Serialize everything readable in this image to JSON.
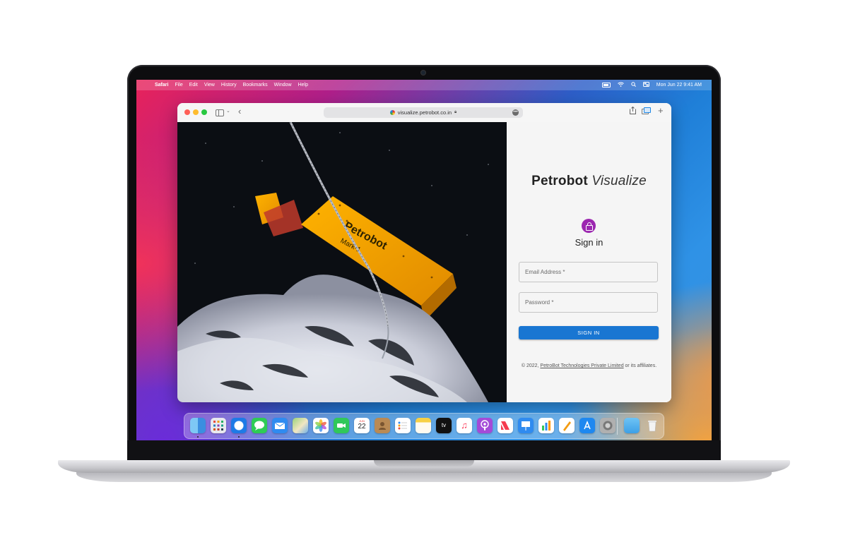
{
  "menubar": {
    "app": "Safari",
    "menus": [
      "File",
      "Edit",
      "View",
      "History",
      "Bookmarks",
      "Window",
      "Help"
    ],
    "clock": "Mon Jun 22  9:41 AM"
  },
  "browser": {
    "url": "visualize.petrobot.co.in"
  },
  "login": {
    "brand_strong": "Petrobot",
    "brand_light": "Visualize",
    "title": "Sign in",
    "email_placeholder": "Email Address *",
    "password_placeholder": "Password *",
    "submit_label": "SIGN IN",
    "copyright_prefix": "© 2022, ",
    "copyright_link": "PetroBot Technologies Private Limited",
    "copyright_suffix": " or its affiliates."
  },
  "hero": {
    "float_line1": "Petrobot",
    "float_line2": "Mark-1"
  },
  "dock": {
    "calendar_month": "JUN",
    "calendar_day": "22",
    "tv_label": "tv",
    "items": [
      "finder-icon",
      "launchpad-icon",
      "safari-icon",
      "messages-icon",
      "mail-icon",
      "maps-icon",
      "photos-icon",
      "facetime-icon",
      "calendar-icon",
      "contacts-icon",
      "reminders-icon",
      "notes-icon",
      "apple-tv-icon",
      "music-icon",
      "podcasts-icon",
      "news-icon",
      "keynote-icon",
      "numbers-icon",
      "pages-icon",
      "app-store-icon",
      "system-preferences-icon",
      "downloads-folder-icon",
      "trash-icon"
    ]
  }
}
